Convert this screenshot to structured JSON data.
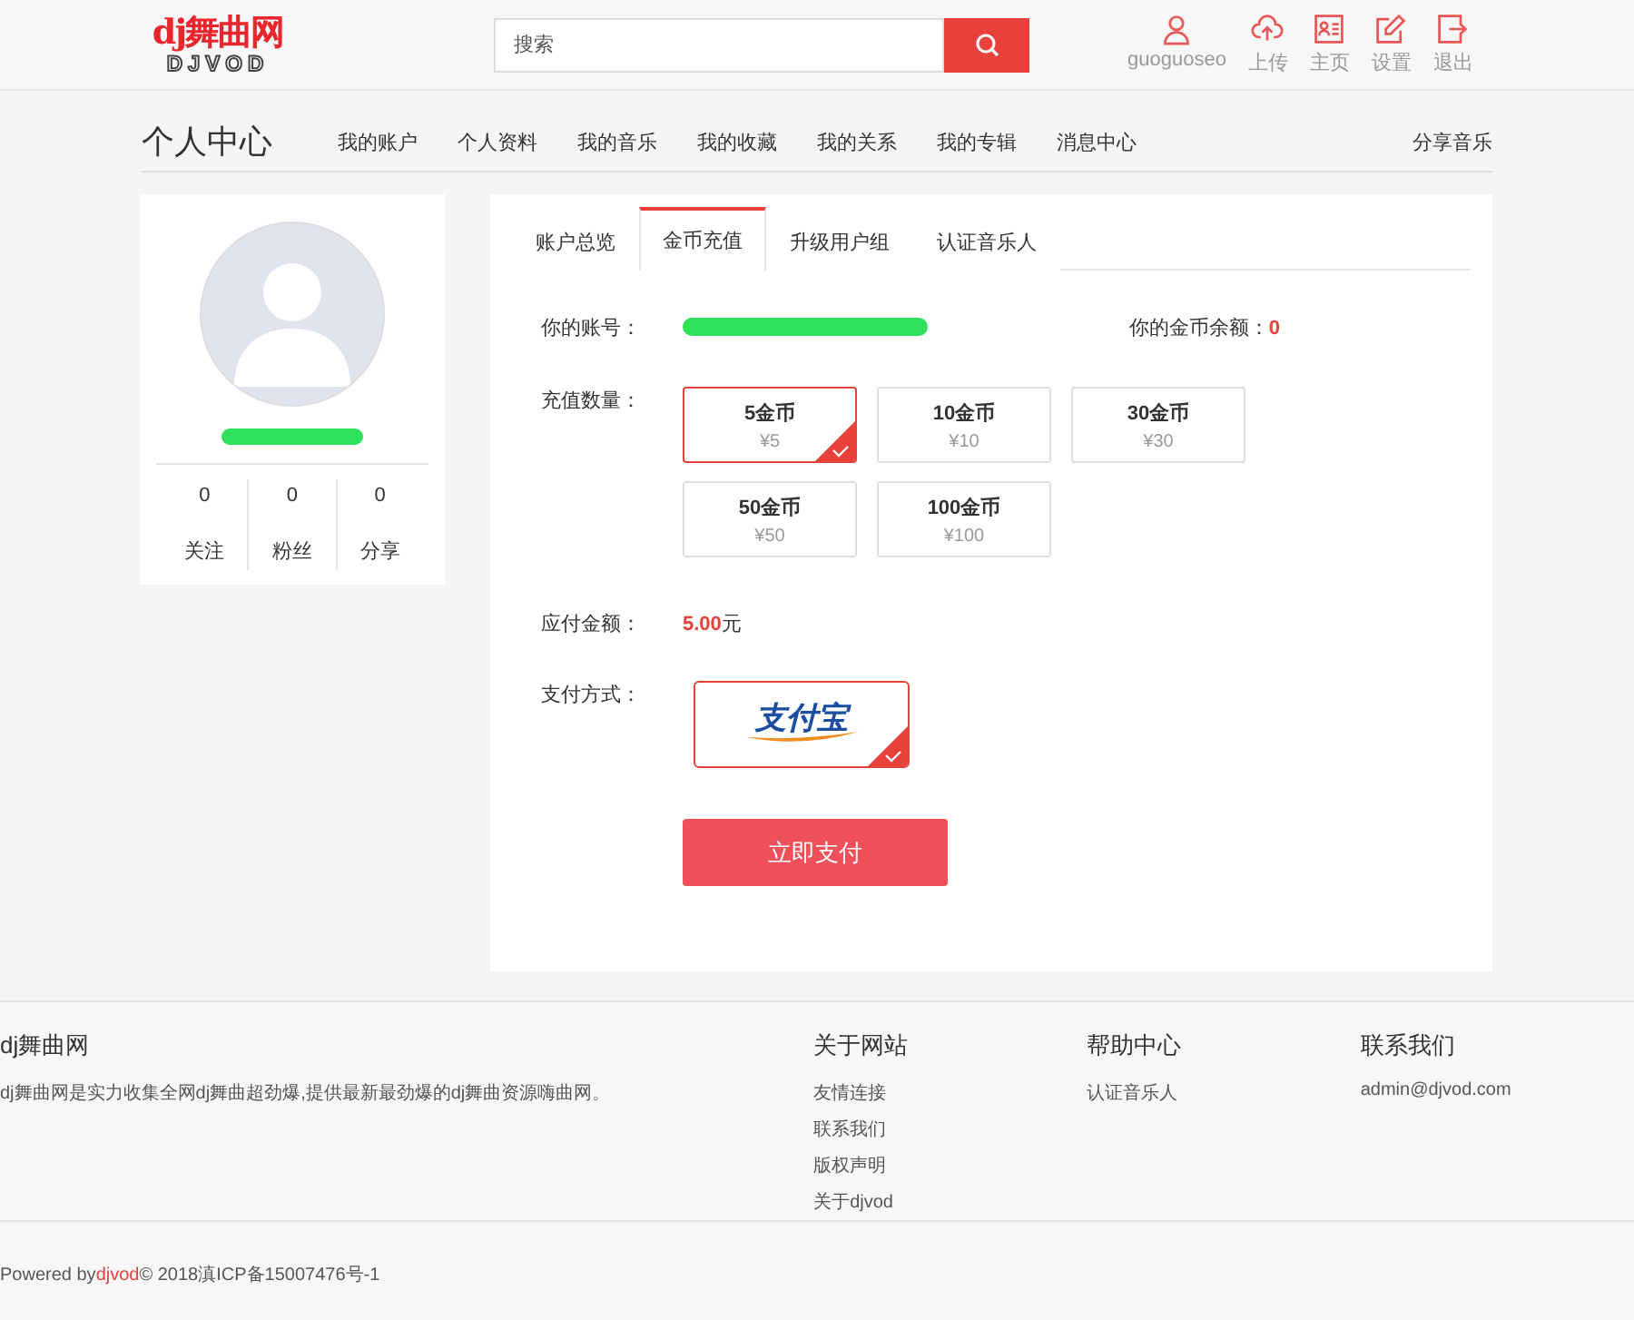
{
  "header": {
    "logo": {
      "title": "dj舞曲网",
      "subtitle": "DJVOD"
    },
    "search": {
      "placeholder": "搜索"
    },
    "user": "guoguoseo",
    "actions": [
      {
        "kind": "upload",
        "label": "上传"
      },
      {
        "kind": "home",
        "label": "主页"
      },
      {
        "kind": "settings",
        "label": "设置"
      },
      {
        "kind": "logout",
        "label": "退出"
      }
    ]
  },
  "subnav": {
    "title": "个人中心",
    "links": [
      "我的账户",
      "个人资料",
      "我的音乐",
      "我的收藏",
      "我的关系",
      "我的专辑",
      "消息中心"
    ],
    "share": "分享音乐"
  },
  "profile": {
    "stats": [
      {
        "value": "0",
        "label": "关注"
      },
      {
        "value": "0",
        "label": "粉丝"
      },
      {
        "value": "0",
        "label": "分享"
      }
    ]
  },
  "tabs": [
    {
      "label": "账户总览",
      "selected": false
    },
    {
      "label": "金币充值",
      "selected": true
    },
    {
      "label": "升级用户组",
      "selected": false
    },
    {
      "label": "认证音乐人",
      "selected": false
    }
  ],
  "account": {
    "label": "你的账号：",
    "balance_label": "你的金币余额：",
    "balance": "0"
  },
  "amount": {
    "label": "充值数量：",
    "options": [
      {
        "coins": "5金币",
        "price": "¥5",
        "selected": true
      },
      {
        "coins": "10金币",
        "price": "¥10",
        "selected": false
      },
      {
        "coins": "30金币",
        "price": "¥30",
        "selected": false
      },
      {
        "coins": "50金币",
        "price": "¥50",
        "selected": false
      },
      {
        "coins": "100金币",
        "price": "¥100",
        "selected": false
      }
    ]
  },
  "due": {
    "label": "应付金额：",
    "value": "5.00",
    "unit": "元"
  },
  "payment": {
    "label": "支付方式：",
    "methods": [
      {
        "kind": "alipay",
        "name": "支付宝",
        "selected": true
      }
    ]
  },
  "pay_button": "立即支付",
  "footer": {
    "about": {
      "title": "dj舞曲网",
      "text": "dj舞曲网是实力收集全网dj舞曲超劲爆,提供最新最劲爆的dj舞曲资源嗨曲网。"
    },
    "columns": [
      {
        "title": "关于网站",
        "links": [
          "友情连接",
          "联系我们",
          "版权声明",
          "关于djvod"
        ]
      },
      {
        "title": "帮助中心",
        "links": [
          "认证音乐人"
        ]
      },
      {
        "title": "联系我们",
        "links": [
          "admin@djvod.com"
        ]
      }
    ],
    "powered": "Powered by",
    "powered_link": "djvod",
    "copyright": "© 2018滇ICP备15007476号-1"
  }
}
